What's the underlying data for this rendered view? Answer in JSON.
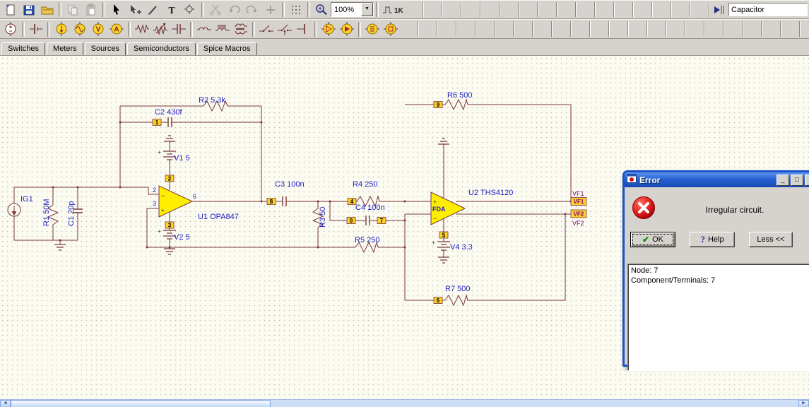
{
  "app": {
    "toolbar": {
      "zoom": "100%",
      "interactive_label": "1K",
      "component_field": "Capacitor"
    },
    "tabs": [
      "Switches",
      "Meters",
      "Sources",
      "Semiconductors",
      "Spice Macros"
    ],
    "icons": {
      "main_toolbar": [
        "new-document-icon",
        "save-icon",
        "open-folder-icon",
        "copy-icon",
        "paste-icon",
        "select-cursor-icon",
        "move-icon",
        "pen-icon",
        "text-tool-icon",
        "probe-icon",
        "cut-icon",
        "undo-icon",
        "redo-icon",
        "add-icon",
        "grid-icon",
        "zoom-icon",
        "zoom-level-combo",
        "interactive-mode-icon",
        "find-component-icon"
      ],
      "component_toolbar": [
        "voltage-source-icon",
        "battery-icon",
        "current-source-icon",
        "generator-icon",
        "voltmeter-icon",
        "ammeter-icon",
        "resistor-icon",
        "potentiometer-icon",
        "capacitor-icon",
        "inductor-icon",
        "iron-core-inductor-icon",
        "transformer-icon",
        "switch-icon",
        "controlled-switch-icon",
        "terminal-icon",
        "ic-icon-1",
        "ic-icon-2",
        "ic-icon-3",
        "ic-icon-4"
      ]
    }
  },
  "circuit": {
    "labels": {
      "ig1": "IG1",
      "r1": "R1 50M",
      "c1": "C1 20p",
      "c2": "C2 430f",
      "r2": "R2 5.3k",
      "v1": "V1 5",
      "u1": "U1 OPA847",
      "v2": "V2 5",
      "c3": "C3 100n",
      "r3": "R3 50",
      "r4": "R4 250",
      "c4": "C4 100n",
      "r5": "R5 250",
      "u2": "U2 THS4120",
      "fda": "FDA",
      "r6": "R6 500",
      "r7": "R7 500",
      "v4": "V4 3.3",
      "vf1": "VF1",
      "vf2": "VF2"
    },
    "pins": {
      "u1_inv": "2",
      "u1_noninv": "3",
      "u1_out": "6"
    },
    "signs": {
      "plus": "+",
      "minus": "−"
    },
    "nodes": {
      "c2_in": "1",
      "u1_vplus": "2",
      "u1_vminus": "3",
      "c3_in": "8",
      "r4_in": "4",
      "c4_in": "0",
      "c4_out": "7",
      "r6_in": "9",
      "r7_in": "6",
      "v4_plus": "5"
    }
  },
  "dialog": {
    "title": "Error",
    "message": "Irregular circuit.",
    "buttons": {
      "ok": "OK",
      "help": "Help",
      "less": "Less <<"
    },
    "details": {
      "line1": "Node: 7",
      "line2": "Component/Terminals: 7"
    }
  }
}
